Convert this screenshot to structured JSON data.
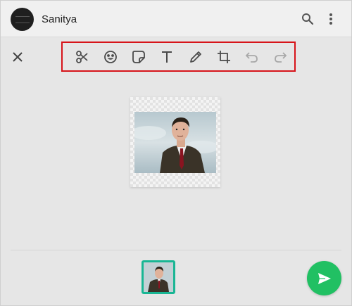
{
  "header": {
    "contact_name": "Sanitya",
    "icons": [
      "avatar",
      "search-icon",
      "more-vertical-icon"
    ]
  },
  "editor": {
    "close_icon": "close-icon",
    "toolbar": [
      {
        "name": "scissors-icon",
        "enabled": true
      },
      {
        "name": "emoji-icon",
        "enabled": true
      },
      {
        "name": "sticker-icon",
        "enabled": true
      },
      {
        "name": "text-icon",
        "enabled": true
      },
      {
        "name": "pencil-icon",
        "enabled": true
      },
      {
        "name": "crop-icon",
        "enabled": true
      },
      {
        "name": "undo-icon",
        "enabled": false
      },
      {
        "name": "redo-icon",
        "enabled": false
      }
    ],
    "highlight_color": "#d7141a"
  },
  "footer": {
    "thumbnail_border_color": "#19b694",
    "send_button_color": "#21c063",
    "send_icon": "send-icon"
  }
}
